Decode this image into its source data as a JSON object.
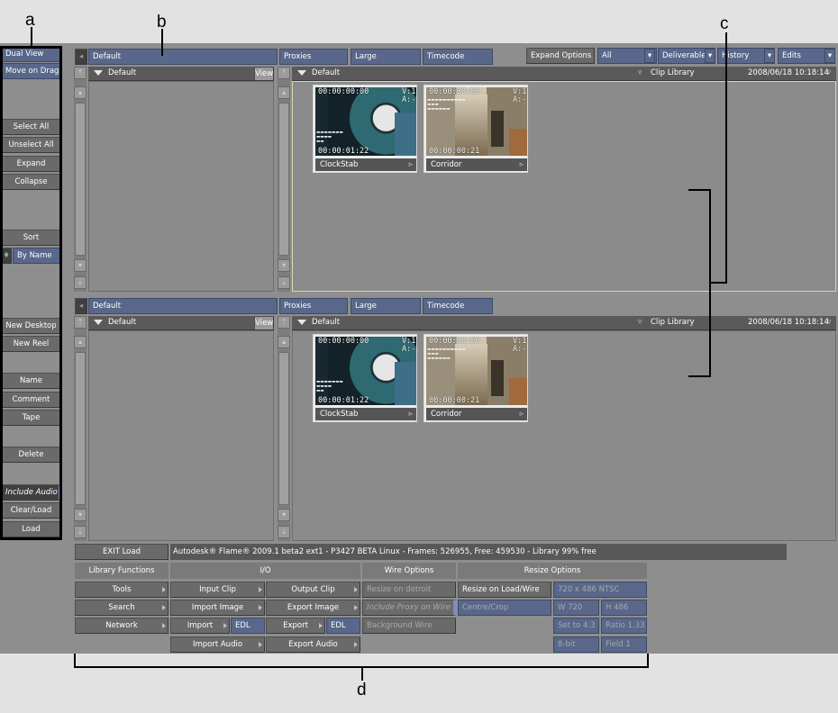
{
  "callouts": {
    "a": "a",
    "b": "b",
    "c": "c",
    "d": "d"
  },
  "left_panel": {
    "dual_view": "Dual View",
    "move_on_drag": "Move on Drag",
    "select_all": "Select All",
    "unselect_all": "Unselect All",
    "expand": "Expand",
    "collapse": "Collapse",
    "sort": "Sort",
    "by_name": "By Name",
    "new_desktop": "New Desktop",
    "new_reel": "New Reel",
    "name": "Name",
    "comment": "Comment",
    "tape": "Tape",
    "delete": "Delete",
    "include_audio": "Include Audio",
    "clear_load": "Clear/Load",
    "load": "Load"
  },
  "top_bar": {
    "default": "Default",
    "proxies": "Proxies",
    "large": "Large",
    "timecode": "Timecode",
    "expand_options": "Expand Options",
    "all": "All",
    "deliverables": "Deliverables",
    "history": "History",
    "edits": "Edits"
  },
  "library_view": {
    "tree_title": "Default",
    "view_label": "View",
    "clip_area_title": "Default",
    "library_label": "Clip Library",
    "timestamp": "2008/06/18 10:18:14"
  },
  "clips": [
    {
      "name": "ClockStab",
      "tc_start": "00:00:00:00",
      "tc_duration": "00:00:01:22",
      "track_v": "V:1",
      "track_a": "A:-"
    },
    {
      "name": "Corridor",
      "tc_start": "00:00:00:00",
      "tc_duration": "00:00:00:21",
      "track_v": "V:1",
      "track_a": "A:-"
    }
  ],
  "status_bar": {
    "exit_load": "EXIT Load",
    "info": "Autodesk® Flame® 2009.1 beta2 ext1 - P3427 BETA Linux - Frames: 526955, Free: 459530 - Library 99% free"
  },
  "functions": {
    "library_functions": "Library Functions",
    "tools": "Tools",
    "search": "Search",
    "network": "Network",
    "io": "I/O",
    "input_clip": "Input Clip",
    "output_clip": "Output Clip",
    "import_image": "Import Image",
    "export_image": "Export Image",
    "import": "Import",
    "edl": "EDL",
    "export": "Export",
    "import_audio": "Import Audio",
    "export_audio": "Export Audio",
    "wire_options": "Wire Options",
    "resize_on_detroit": "Resize on detroit",
    "include_proxy_on_wire": "Include Proxy on Wire",
    "background_wire": "Background Wire",
    "resize_options": "Resize Options",
    "resize_on_load_wire": "Resize on Load/Wire",
    "format": "720 x 486 NTSC",
    "centre_crop": "Centre/Crop",
    "width": "W 720",
    "height": "H 486",
    "set_to": "Set to 4:3",
    "ratio": "Ratio 1.333",
    "bit_depth": "8-bit",
    "field": "Field 1"
  }
}
